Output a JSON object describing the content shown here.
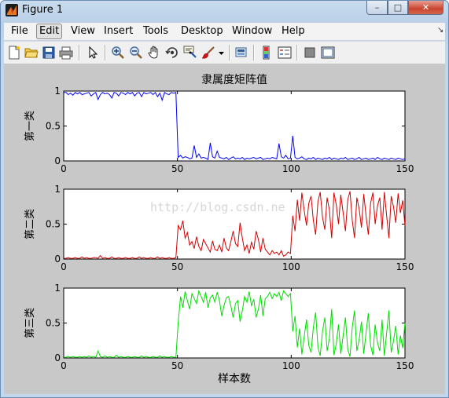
{
  "window": {
    "title": "Figure 1",
    "controls": {
      "minimize": "–",
      "maximize": "□",
      "close": "✕"
    }
  },
  "menubar": {
    "items": [
      {
        "label": "File",
        "active": false
      },
      {
        "label": "Edit",
        "active": true
      },
      {
        "label": "View",
        "active": false
      },
      {
        "label": "Insert",
        "active": false
      },
      {
        "label": "Tools",
        "active": false
      },
      {
        "label": "Desktop",
        "active": false
      },
      {
        "label": "Window",
        "active": false
      },
      {
        "label": "Help",
        "active": false
      }
    ],
    "dock_arrow": "↘"
  },
  "toolbar": {
    "icons": [
      "new-figure-icon",
      "open-folder-icon",
      "save-icon",
      "print-icon",
      "pointer-arrow-icon",
      "zoom-in-icon",
      "zoom-out-icon",
      "pan-hand-icon",
      "rotate-3d-icon",
      "data-cursor-icon",
      "brush-icon",
      "brush-dropdown-icon",
      "link-plot-icon",
      "colorbar-icon",
      "legend-icon",
      "hide-plot-tools-icon",
      "show-plot-tools-icon"
    ]
  },
  "figure": {
    "watermark": "http://blog.csdn.ne",
    "colors": {
      "background": "#c8c8c8",
      "series1": "#0000ff",
      "series2": "#d40000",
      "series3": "#00dd00"
    }
  },
  "chart_data": [
    {
      "type": "line",
      "title": "隶属度矩阵值",
      "xlabel": "",
      "ylabel": "第一类",
      "xlim": [
        0,
        150
      ],
      "ylim": [
        0,
        1
      ],
      "xticks": [
        "0",
        "50",
        "100",
        "150"
      ],
      "yticks": [
        "0",
        "0.5",
        "1"
      ],
      "series": [
        {
          "color": "#0000ff",
          "values": [
            0.98,
            0.98,
            0.95,
            0.97,
            0.94,
            0.98,
            0.96,
            0.98,
            0.95,
            0.96,
            0.97,
            0.98,
            0.93,
            0.96,
            0.98,
            0.88,
            0.95,
            0.98,
            0.96,
            0.97,
            0.95,
            0.9,
            0.98,
            0.97,
            0.93,
            0.98,
            0.97,
            0.95,
            0.98,
            0.96,
            0.98,
            0.93,
            0.97,
            0.98,
            0.92,
            0.98,
            0.96,
            0.97,
            0.98,
            0.95,
            0.98,
            0.92,
            0.97,
            0.87,
            0.98,
            0.96,
            0.95,
            0.98,
            0.97,
            0.98,
            0.05,
            0.08,
            0.04,
            0.06,
            0.05,
            0.03,
            0.04,
            0.22,
            0.05,
            0.1,
            0.04,
            0.05,
            0.04,
            0.02,
            0.26,
            0.06,
            0.04,
            0.14,
            0.05,
            0.04,
            0.03,
            0.05,
            0.02,
            0.04,
            0.06,
            0.03,
            0.04,
            0.03,
            0.05,
            0.02,
            0.04,
            0.03,
            0.04,
            0.05,
            0.03,
            0.04,
            0.05,
            0.02,
            0.03,
            0.04,
            0.03,
            0.05,
            0.04,
            0.03,
            0.25,
            0.06,
            0.04,
            0.08,
            0.03,
            0.04,
            0.36,
            0.05,
            0.03,
            0.04,
            0.06,
            0.03,
            0.02,
            0.04,
            0.03,
            0.05,
            0.02,
            0.04,
            0.03,
            0.02,
            0.04,
            0.03,
            0.05,
            0.02,
            0.04,
            0.03,
            0.02,
            0.04,
            0.03,
            0.05,
            0.02,
            0.03,
            0.04,
            0.02,
            0.03,
            0.05,
            0.02,
            0.03,
            0.04,
            0.02,
            0.03,
            0.04,
            0.02,
            0.05,
            0.03,
            0.02,
            0.04,
            0.03,
            0.02,
            0.04,
            0.03,
            0.02,
            0.04,
            0.03,
            0.02,
            0.03
          ]
        }
      ]
    },
    {
      "type": "line",
      "title": "",
      "xlabel": "",
      "ylabel": "第二类",
      "xlim": [
        0,
        150
      ],
      "ylim": [
        0,
        1
      ],
      "xticks": [
        "0",
        "50",
        "100",
        "150"
      ],
      "yticks": [
        "0",
        "0.5",
        "1"
      ],
      "series": [
        {
          "color": "#d40000",
          "values": [
            0.01,
            0.01,
            0.02,
            0.01,
            0.01,
            0.02,
            0.01,
            0.01,
            0.03,
            0.01,
            0.02,
            0.01,
            0.01,
            0.02,
            0.02,
            0.01,
            0.05,
            0.01,
            0.02,
            0.01,
            0.01,
            0.03,
            0.01,
            0.01,
            0.02,
            0.01,
            0.01,
            0.02,
            0.01,
            0.01,
            0.02,
            0.01,
            0.01,
            0.03,
            0.01,
            0.02,
            0.01,
            0.01,
            0.02,
            0.01,
            0.01,
            0.03,
            0.01,
            0.02,
            0.01,
            0.01,
            0.02,
            0.01,
            0.01,
            0.02,
            0.48,
            0.42,
            0.55,
            0.3,
            0.38,
            0.2,
            0.25,
            0.15,
            0.32,
            0.18,
            0.12,
            0.28,
            0.22,
            0.16,
            0.1,
            0.26,
            0.14,
            0.12,
            0.2,
            0.1,
            0.3,
            0.16,
            0.12,
            0.25,
            0.4,
            0.22,
            0.18,
            0.52,
            0.3,
            0.12,
            0.2,
            0.08,
            0.24,
            0.14,
            0.4,
            0.28,
            0.1,
            0.3,
            0.14,
            0.1,
            0.06,
            0.12,
            0.08,
            0.1,
            0.06,
            0.12,
            0.04,
            0.06,
            0.1,
            0.08,
            0.62,
            0.4,
            0.85,
            0.55,
            0.95,
            0.7,
            0.48,
            0.8,
            0.9,
            0.55,
            0.35,
            0.82,
            0.96,
            0.6,
            0.42,
            0.88,
            0.7,
            0.3,
            0.95,
            0.78,
            0.5,
            0.92,
            0.66,
            0.4,
            0.85,
            0.97,
            0.55,
            0.3,
            0.88,
            0.72,
            0.45,
            0.93,
            0.62,
            0.35,
            0.8,
            0.95,
            0.5,
            0.76,
            0.88,
            0.42,
            0.96,
            0.62,
            0.3,
            0.9,
            0.75,
            0.52,
            0.94,
            0.66,
            0.84,
            0.48
          ]
        }
      ]
    },
    {
      "type": "line",
      "title": "",
      "xlabel": "样本数",
      "ylabel": "第三类",
      "xlim": [
        0,
        150
      ],
      "ylim": [
        0,
        1
      ],
      "xticks": [
        "0",
        "50",
        "100",
        "150"
      ],
      "yticks": [
        "0",
        "0.5",
        "1"
      ],
      "series": [
        {
          "color": "#00dd00",
          "values": [
            0.01,
            0.01,
            0.02,
            0.01,
            0.02,
            0.01,
            0.01,
            0.02,
            0.01,
            0.02,
            0.01,
            0.03,
            0.01,
            0.02,
            0.01,
            0.1,
            0.02,
            0.01,
            0.03,
            0.01,
            0.02,
            0.01,
            0.01,
            0.04,
            0.01,
            0.02,
            0.01,
            0.01,
            0.02,
            0.01,
            0.01,
            0.02,
            0.01,
            0.01,
            0.03,
            0.01,
            0.02,
            0.01,
            0.01,
            0.02,
            0.01,
            0.01,
            0.03,
            0.01,
            0.02,
            0.01,
            0.01,
            0.02,
            0.01,
            0.01,
            0.5,
            0.88,
            0.72,
            0.95,
            0.82,
            0.7,
            0.92,
            0.85,
            0.78,
            0.96,
            0.88,
            0.8,
            0.94,
            0.72,
            0.86,
            0.9,
            0.8,
            0.94,
            0.82,
            0.6,
            0.75,
            0.86,
            0.88,
            0.74,
            0.58,
            0.78,
            0.82,
            0.52,
            0.68,
            0.88,
            0.8,
            0.95,
            0.75,
            0.84,
            0.58,
            0.7,
            0.9,
            0.6,
            0.85,
            0.88,
            0.94,
            0.85,
            0.92,
            0.88,
            0.94,
            0.82,
            0.96,
            0.92,
            0.88,
            0.92,
            0.38,
            0.6,
            0.15,
            0.42,
            0.05,
            0.3,
            0.55,
            0.18,
            0.08,
            0.44,
            0.65,
            0.16,
            0.03,
            0.38,
            0.58,
            0.1,
            0.28,
            0.7,
            0.04,
            0.2,
            0.48,
            0.06,
            0.32,
            0.58,
            0.12,
            0.02,
            0.44,
            0.68,
            0.1,
            0.26,
            0.52,
            0.06,
            0.36,
            0.64,
            0.18,
            0.04,
            0.48,
            0.22,
            0.1,
            0.55,
            0.03,
            0.36,
            0.68,
            0.08,
            0.24,
            0.46,
            0.05,
            0.32,
            0.14,
            0.5
          ]
        }
      ]
    }
  ]
}
